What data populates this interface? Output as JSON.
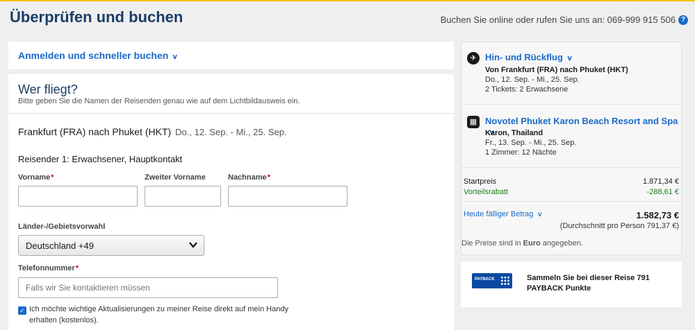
{
  "header": {
    "title": "Überprüfen und buchen",
    "phone_text": "Buchen Sie online oder rufen Sie uns an: 069-999 915 506",
    "help_icon": "question-circle-icon"
  },
  "login": {
    "link_label": "Anmelden und schneller buchen"
  },
  "travelers": {
    "title": "Wer fliegt?",
    "subtitle": "Bitte geben Sie die Namen der Reisenden genau wie auf dem Lichtbildausweis ein.",
    "route": "Frankfurt (FRA) nach Phuket (HKT)",
    "route_dates": "Do., 12. Sep. - Mi., 25. Sep.",
    "traveler_heading": "Reisender 1: Erwachsener, Hauptkontakt",
    "fields": {
      "first_name_label": "Vorname",
      "middle_name_label": "Zweiter Vorname",
      "last_name_label": "Nachname",
      "country_code_label": "Länder-/Gebietsvorwahl",
      "country_code_value": "Deutschland +49",
      "phone_label": "Telefonnummer",
      "phone_placeholder": "Falls wir Sie kontaktieren müssen",
      "required_marker": "*"
    },
    "sms_checkbox": {
      "checked": true,
      "label": "Ich möchte wichtige Aktualisierungen zu meiner Reise direkt auf mein Handy erhalten (kostenlos)."
    }
  },
  "summary": {
    "flight": {
      "icon": "airplane-icon",
      "title": "Hin- und Rückflug",
      "route": "Von Frankfurt (FRA) nach Phuket (HKT)",
      "dates": "Do., 12. Sep. - Mi., 25. Sep.",
      "tickets": "2 Tickets: 2 Erwachsene"
    },
    "hotel": {
      "icon": "building-icon",
      "title": "Novotel Phuket Karon Beach Resort and Spa",
      "location": "Karon, Thailand",
      "dates": "Fr., 13. Sep. - Mi., 25. Sep.",
      "rooms": "1 Zimmer: 12 Nächte"
    },
    "prices": {
      "start_label": "Startpreis",
      "start_value": "1.871,34 €",
      "discount_label": "Vorteilsrabatt",
      "discount_value": "-288,61 €",
      "due_label": "Heute fälliger Betrag",
      "due_value": "1.582,73 €",
      "per_person": "(Durchschnitt pro Person 791,37 €)",
      "currency_note_pre": "Die Preise sind in ",
      "currency_note_bold": "Euro",
      "currency_note_post": " angegeben."
    },
    "colors": {
      "link": "#1b6ac9",
      "discount": "#1e7c1e",
      "title": "#1a3d66"
    }
  },
  "payback": {
    "logo_text": "PAYBACK",
    "text": "Sammeln Sie bei dieser Reise 791 PAYBACK Punkte"
  }
}
